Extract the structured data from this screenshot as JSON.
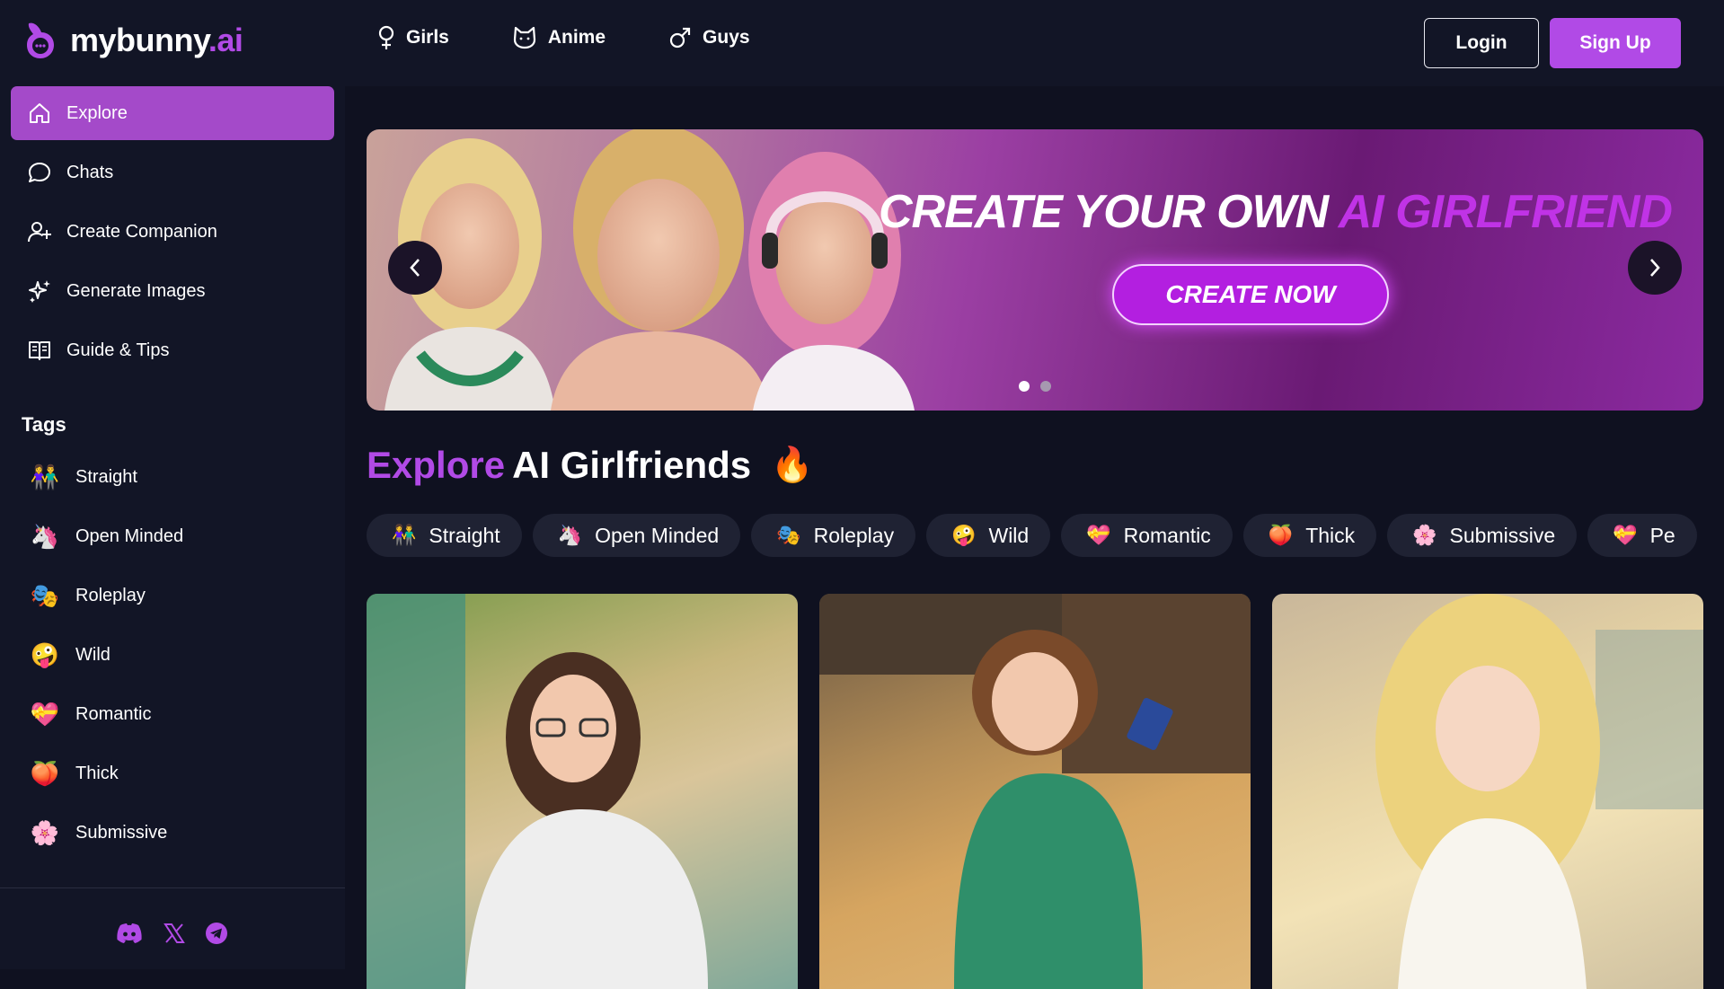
{
  "brand": {
    "name": "mybunny",
    "domain": ".ai",
    "accent": "#b14ae6"
  },
  "topnav": [
    {
      "label": "Girls",
      "icon": "female-symbol-icon"
    },
    {
      "label": "Anime",
      "icon": "cat-face-icon"
    },
    {
      "label": "Guys",
      "icon": "male-symbol-icon"
    }
  ],
  "auth": {
    "login": "Login",
    "signup": "Sign Up"
  },
  "sidebar": {
    "items": [
      {
        "label": "Explore",
        "icon": "home-icon",
        "active": true
      },
      {
        "label": "Chats",
        "icon": "chat-bubble-icon"
      },
      {
        "label": "Create Companion",
        "icon": "add-user-icon"
      },
      {
        "label": "Generate Images",
        "icon": "sparkles-icon"
      },
      {
        "label": "Guide & Tips",
        "icon": "book-icon"
      }
    ],
    "tags_title": "Tags",
    "tags": [
      {
        "label": "Straight",
        "emoji": "👫"
      },
      {
        "label": "Open Minded",
        "emoji": "🦄"
      },
      {
        "label": "Roleplay",
        "emoji": "🎭"
      },
      {
        "label": "Wild",
        "emoji": "🤪"
      },
      {
        "label": "Romantic",
        "emoji": "💝"
      },
      {
        "label": "Thick",
        "emoji": "🍑"
      },
      {
        "label": "Submissive",
        "emoji": "🌸"
      }
    ],
    "socials": [
      "discord-icon",
      "x-icon",
      "telegram-icon"
    ]
  },
  "banner": {
    "title_main": "CREATE YOUR OWN ",
    "title_highlight": "AI GIRLFRIEND",
    "cta": "CREATE NOW",
    "slides": 2,
    "active_slide": 1
  },
  "section": {
    "title_prefix": "Explore",
    "title_rest": " AI Girlfriends",
    "emoji": "🔥"
  },
  "chips": [
    {
      "label": "Straight",
      "emoji": "👫"
    },
    {
      "label": "Open Minded",
      "emoji": "🦄"
    },
    {
      "label": "Roleplay",
      "emoji": "🎭"
    },
    {
      "label": "Wild",
      "emoji": "🤪"
    },
    {
      "label": "Romantic",
      "emoji": "💝"
    },
    {
      "label": "Thick",
      "emoji": "🍑"
    },
    {
      "label": "Submissive",
      "emoji": "🌸"
    },
    {
      "label": "Pe",
      "emoji": "💝"
    }
  ]
}
